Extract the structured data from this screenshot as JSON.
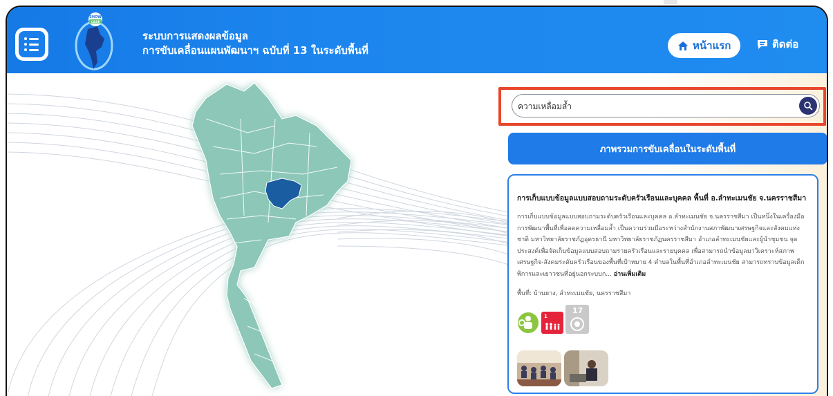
{
  "header": {
    "title_line1": "ระบบการแสดงผลข้อมูล",
    "title_line2": "การขับเคลื่อนแผนพัฒนาฯ ฉบับที่ 13 ในระดับพื้นที่",
    "logo_text": "SHOW CASE",
    "nav_home": "หน้าแรก",
    "nav_contact": "ติดต่อ",
    "brand_color": "#1f8cf0"
  },
  "search": {
    "value": "ความเหลื่อมล้ำ",
    "highlight_color": "#e8472d"
  },
  "overview_button": "ภาพรวมการขับเคลื่อนในระดับพื้นที่",
  "card": {
    "title": "การเก็บแบบข้อมูลแบบสอบถามระดับครัวเรือนและบุคคล พื้นที่ อ.ลำทะเมนชัย จ.นครราชสีมา",
    "description": "การเก็บแบบข้อมูลแบบสอบถามระดับครัวเรือนและบุคคล อ.ลำทะเมนชัย จ.นครราชสีมา เป็นหนึ่งในเครื่องมือการพัฒนาพื้นที่เพื่อลดความเหลื่อมล้ำ เป็นความร่วมมือระหว่างสำนักงานสภาพัฒนาเศรษฐกิจและสังคมแห่งชาติ มหาวิทยาลัยราชภัฏอุดรธานี มหาวิทยาลัยราชภัฏนครราชสีมา อำเภอลำทะเมนชัยและผู้นำชุมชน จุดประสงค์เพื่อจัดเก็บข้อมูลแบบสอบถามรายครัวเรือนและรายบุคคล เพื่อสามารถนำข้อมูลมาวิเคราะห์สภาพเศรษฐกิจ-สังคมระดับครัวเรือนของพื้นที่เป้าหมาย 4 ตำบลในพื้นที่อำเภอลำทะเมนชัย สามารถทราบข้อมูลเด็กพิการและเยาวชนที่อยู่นอกระบบก...",
    "read_more": "อ่านเพิ่มเติม",
    "area_label": "พื้นที่: บ้านยาง, ลำทะเมนชัย, นครราชสีมา",
    "sdg_icons": [
      "sdg-people-icon",
      "sdg-1-no-poverty-icon",
      "sdg-17-partnership-icon"
    ],
    "sdg_17_number": "17",
    "photos": [
      "meeting-photo",
      "interview-photo"
    ]
  }
}
